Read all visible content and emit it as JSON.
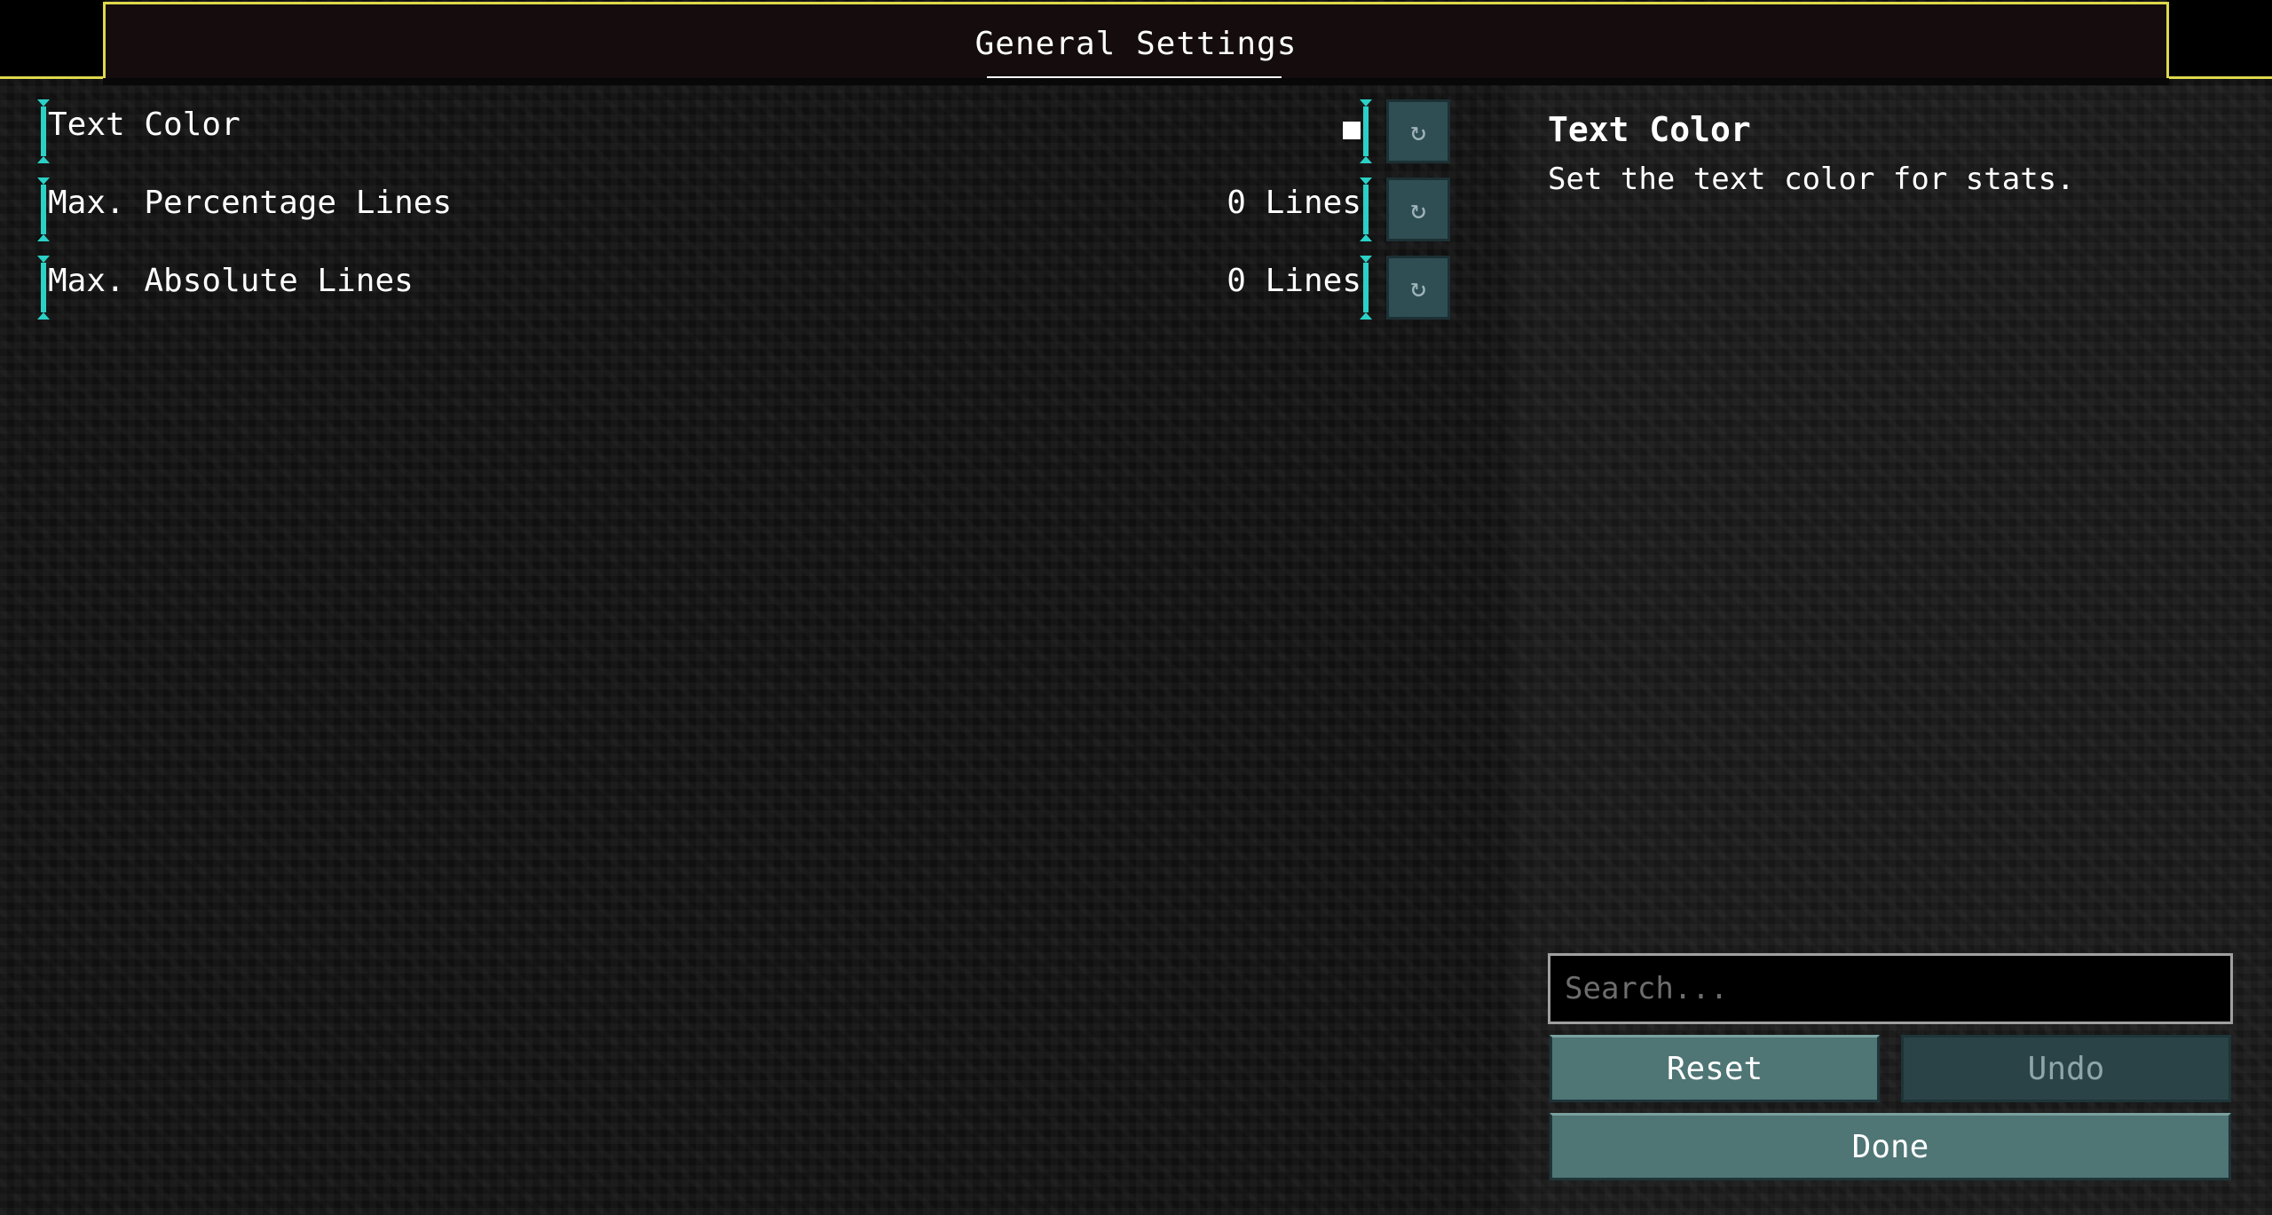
{
  "header": {
    "title": "General Settings"
  },
  "settings": {
    "rows": [
      {
        "label": "Text Color",
        "value": "",
        "reset_icon": "↻"
      },
      {
        "label": "Max. Percentage Lines",
        "value": "0 Lines",
        "reset_icon": "↻"
      },
      {
        "label": "Max. Absolute Lines",
        "value": "0 Lines",
        "reset_icon": "↻"
      }
    ],
    "text_color_swatch": "#ffffff"
  },
  "description": {
    "title": "Text Color",
    "text": "Set the text color for stats."
  },
  "search": {
    "placeholder": "Search..."
  },
  "buttons": {
    "reset_label": "Reset",
    "undo_label": "Undo",
    "done_label": "Done"
  },
  "colors": {
    "accent_yellow": "#ddd84a",
    "marker_cyan": "#2bd1c6"
  }
}
